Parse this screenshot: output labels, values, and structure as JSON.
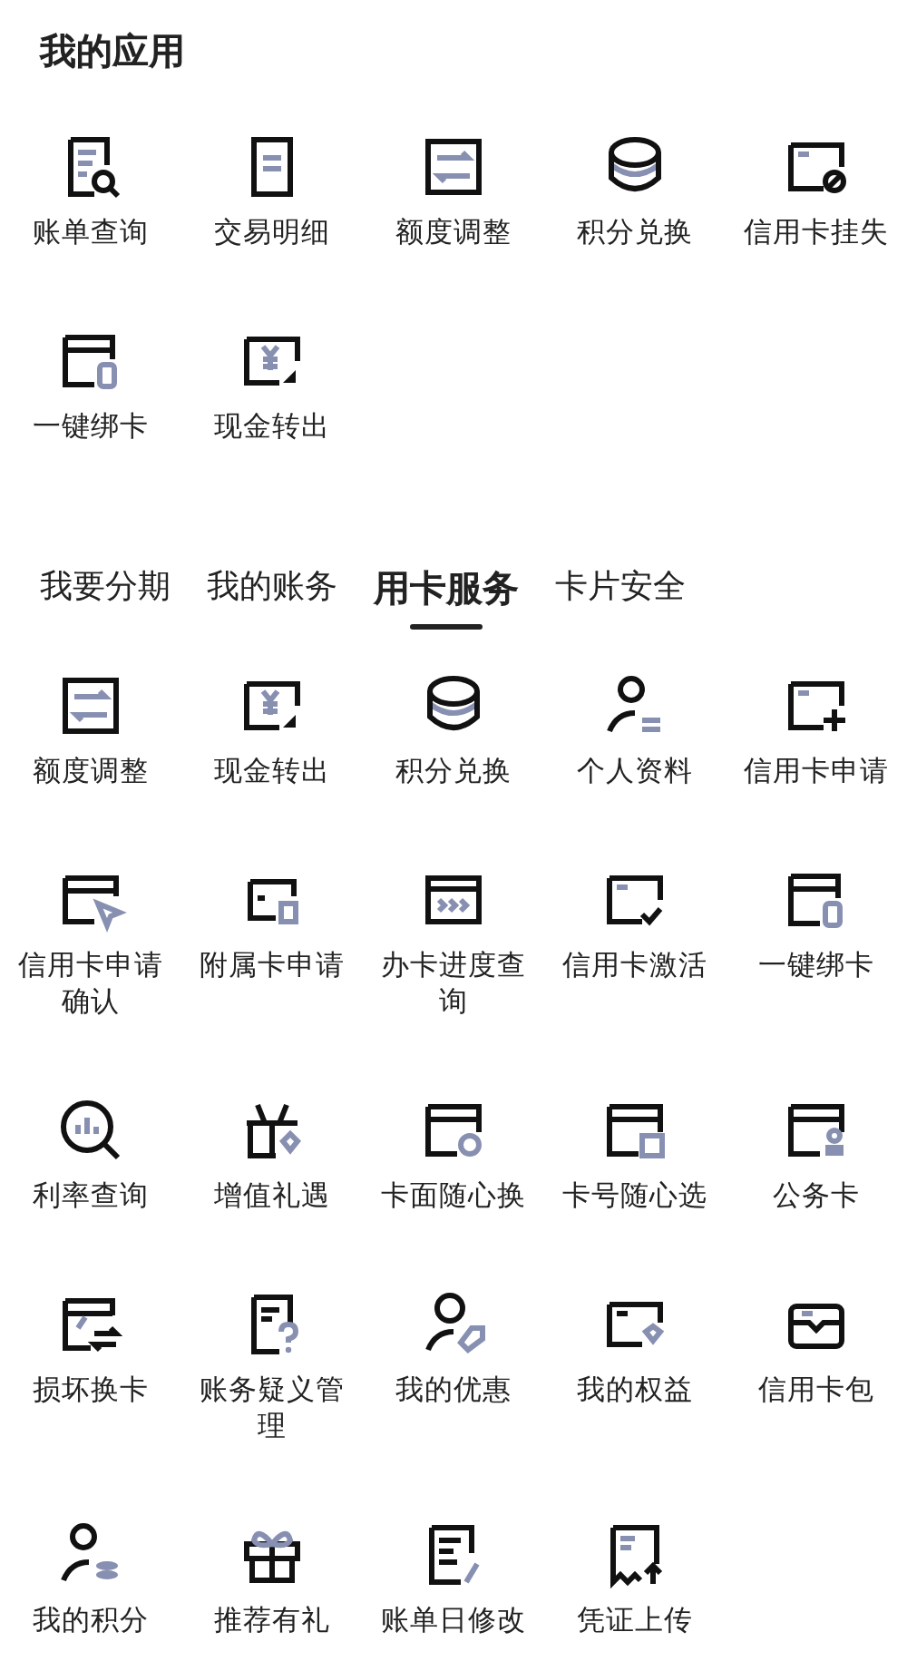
{
  "my_apps": {
    "title": "我的应用",
    "items": [
      {
        "label": "账单查询",
        "kind": "bill-search"
      },
      {
        "label": "交易明细",
        "kind": "document"
      },
      {
        "label": "额度调整",
        "kind": "transfer"
      },
      {
        "label": "积分兑换",
        "kind": "coins"
      },
      {
        "label": "信用卡挂失",
        "kind": "card-block"
      },
      {
        "label": "一键绑卡",
        "kind": "card-link"
      },
      {
        "label": "现金转出",
        "kind": "cash"
      }
    ]
  },
  "tabs": [
    {
      "label": "我要分期",
      "selected": false
    },
    {
      "label": "我的账务",
      "selected": false
    },
    {
      "label": "用卡服务",
      "selected": true
    },
    {
      "label": "卡片安全",
      "selected": false
    }
  ],
  "services": [
    {
      "label": "额度调整",
      "kind": "transfer"
    },
    {
      "label": "现金转出",
      "kind": "cash"
    },
    {
      "label": "积分兑换",
      "kind": "coins"
    },
    {
      "label": "个人资料",
      "kind": "person"
    },
    {
      "label": "信用卡申请",
      "kind": "card-add"
    },
    {
      "label": "信用卡申请确认",
      "kind": "card-pointer"
    },
    {
      "label": "附属卡申请",
      "kind": "card-sub"
    },
    {
      "label": "办卡进度查询",
      "kind": "card-progress"
    },
    {
      "label": "信用卡激活",
      "kind": "card-check"
    },
    {
      "label": "一键绑卡",
      "kind": "card-link"
    },
    {
      "label": "利率查询",
      "kind": "search-chart"
    },
    {
      "label": "增值礼遇",
      "kind": "gift-basket"
    },
    {
      "label": "卡面随心换",
      "kind": "card-palette"
    },
    {
      "label": "卡号随心选",
      "kind": "card-number"
    },
    {
      "label": "公务卡",
      "kind": "card-person"
    },
    {
      "label": "损坏换卡",
      "kind": "card-swap"
    },
    {
      "label": "账务疑义管理",
      "kind": "doc-question"
    },
    {
      "label": "我的优惠",
      "kind": "person-tag"
    },
    {
      "label": "我的权益",
      "kind": "card-diamond"
    },
    {
      "label": "信用卡包",
      "kind": "wallet"
    },
    {
      "label": "我的积分",
      "kind": "person-coins"
    },
    {
      "label": "推荐有礼",
      "kind": "gift"
    },
    {
      "label": "账单日修改",
      "kind": "doc-edit"
    },
    {
      "label": "凭证上传",
      "kind": "receipt-upload"
    }
  ]
}
